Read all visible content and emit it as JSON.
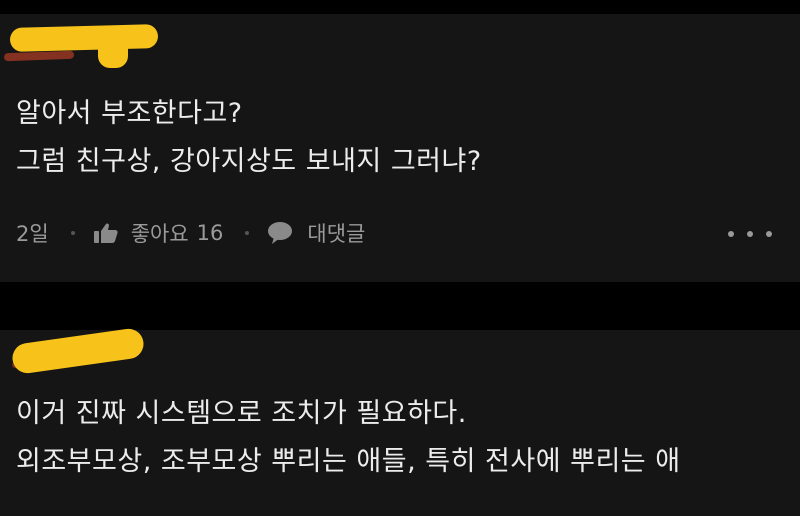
{
  "comments": [
    {
      "lines": [
        "알아서 부조한다고?",
        "그럼 친구상, 강아지상도 보내지 그러냐?"
      ],
      "time": "2일",
      "like_label": "좋아요",
      "like_count": "16",
      "reply_label": "대댓글"
    },
    {
      "lines": [
        "이거 진짜 시스템으로 조치가 필요하다.",
        "외조부모상, 조부모상 뿌리는 애들, 특히 전사에 뿌리는 애"
      ]
    }
  ],
  "icons": {
    "like": "thumbs-up-icon",
    "reply": "speech-bubble-icon",
    "more": "more-horizontal-icon"
  },
  "colors": {
    "redaction": "#f7c31a",
    "card_background": "#151515",
    "page_background": "#000000",
    "text": "#ececec",
    "meta_text": "#9a9a9a"
  }
}
